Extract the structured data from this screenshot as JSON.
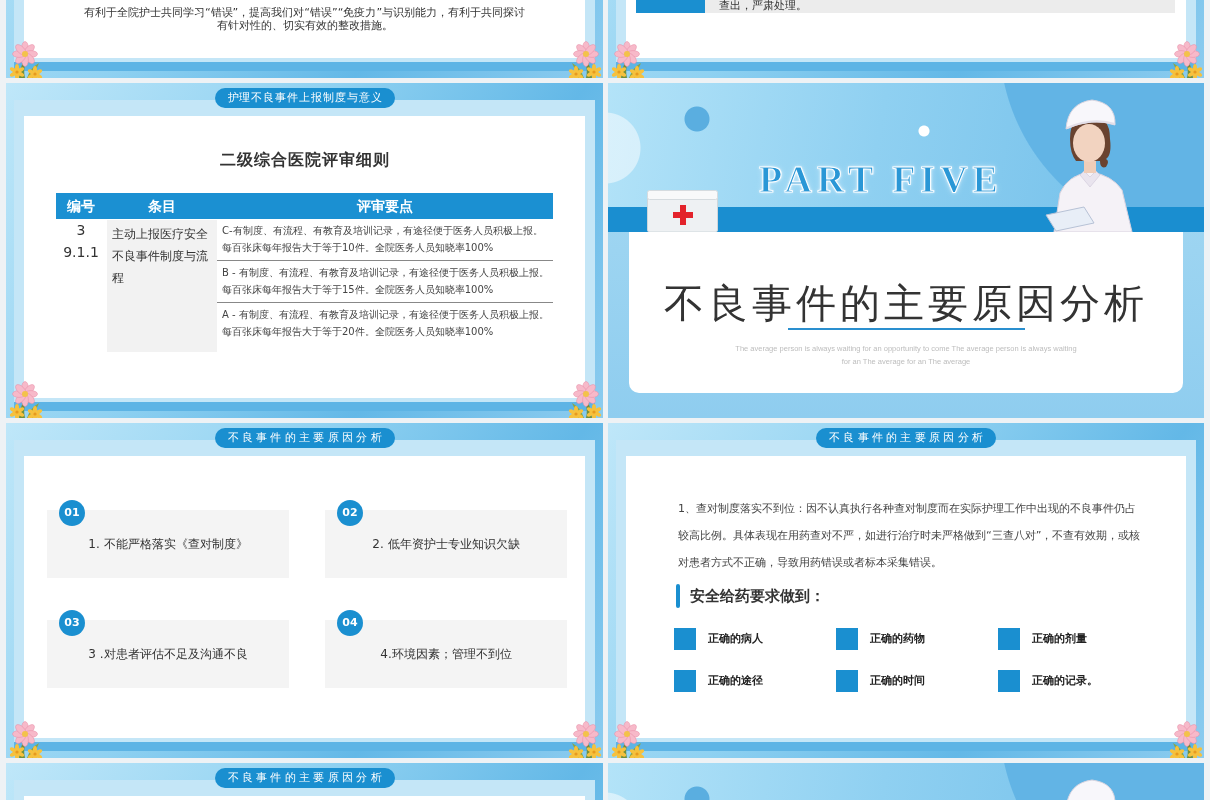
{
  "slides": [
    {
      "kind": "note",
      "paragraph": "有利于全院护士共同学习“错误”，提高我们对“错误”“免疫力”与识别能力，有利于共同探讨有针对性的、切实有效的整改措施。"
    },
    {
      "kind": "callout",
      "text": "查出，严肃处理。"
    },
    {
      "kind": "table",
      "tab": "护理不良事件上报制度与意义",
      "title": "二级综合医院评审细则",
      "table": {
        "columns": [
          "编号",
          "条目",
          "评审要点"
        ],
        "rows": [
          {
            "code": "3\n9.1.1",
            "item": "主动上报医疗安全不良事件制度与流程",
            "points": [
              "C-有制度、有流程、有教育及培训记录，有途径便于医务人员积极上报。每百张床每年报告大于等于10件。全院医务人员知晓率100%",
              "B - 有制度、有流程、有教育及培训记录，有途径便于医务人员积极上报。每百张床每年报告大于等于15件。全院医务人员知晓率100%",
              "A - 有制度、有流程、有教育及培训记录，有途径便于医务人员积极上报。每百张床每年报告大于等于20件。全院医务人员知晓率100%"
            ]
          }
        ]
      }
    },
    {
      "kind": "section",
      "part": "PART FIVE",
      "title": "不良事件的主要原因分析",
      "subtitle": "The average person is always waiting for an opportunity to come The average person is always waiting\nfor an The average for an The average"
    },
    {
      "kind": "cards",
      "tab": "不良事件的主要原因分析",
      "cards": [
        {
          "number": "01",
          "text": "1. 不能严格落实《查对制度》"
        },
        {
          "number": "02",
          "text": "2. 低年资护士专业知识欠缺"
        },
        {
          "number": "03",
          "text": "3 .对患者评估不足及沟通不良"
        },
        {
          "number": "04",
          "text": "4.环境因素；管理不到位"
        }
      ]
    },
    {
      "kind": "detail",
      "tab": "不良事件的主要原因分析",
      "paragraph": "1、查对制度落实不到位：因不认真执行各种查对制度而在实际护理工作中出现的不良事件仍占较高比例。具体表现在用药查对不严，如进行治疗时未严格做到“三查八对”，不查有效期，或核对患者方式不正确，导致用药错误或者标本采集错误。",
      "heading": "安全给药要求做到：",
      "items": [
        "正确的病人",
        "正确的药物",
        "正确的剂量",
        "正确的途径",
        "正确的时间",
        "正确的记录。"
      ]
    },
    {
      "kind": "blank",
      "tab": "不良事件的主要原因分析"
    },
    {
      "kind": "section_top"
    }
  ]
}
